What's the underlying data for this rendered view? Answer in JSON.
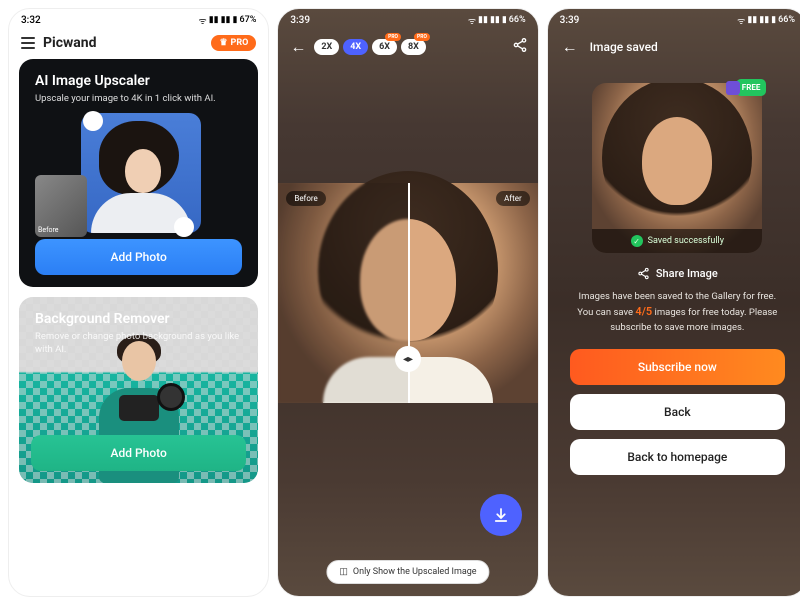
{
  "screen1": {
    "status": {
      "time": "3:32",
      "battery": "67%"
    },
    "brand": "Picwand",
    "pro": "PRO",
    "card1": {
      "title": "AI Image Upscaler",
      "subtitle": "Upscale your image to 4K in 1 click with AI.",
      "before": "Before",
      "button": "Add Photo"
    },
    "card2": {
      "title": "Background Remover",
      "subtitle": "Remove or change photo background as you like with AI.",
      "button": "Add Photo"
    }
  },
  "screen2": {
    "status": {
      "time": "3:39",
      "battery": "66%"
    },
    "zooms": [
      {
        "label": "2X",
        "active": false,
        "pro": false
      },
      {
        "label": "4X",
        "active": true,
        "pro": false
      },
      {
        "label": "6X",
        "active": false,
        "pro": true
      },
      {
        "label": "8X",
        "active": false,
        "pro": true
      }
    ],
    "proTag": "PRO",
    "before": "Before",
    "after": "After",
    "toggle": "Only Show the Upscaled Image"
  },
  "screen3": {
    "status": {
      "time": "3:39",
      "battery": "66%"
    },
    "title": "Image saved",
    "free": "FREE",
    "savedStrip": "Saved successfully",
    "shareLabel": "Share Image",
    "desc1": "Images have been saved to the Gallery for free. You can save ",
    "count": "4/5",
    "desc2": " images for free today. Please subscribe to save more images.",
    "subscribe": "Subscribe now",
    "back": "Back",
    "home": "Back to homepage"
  }
}
